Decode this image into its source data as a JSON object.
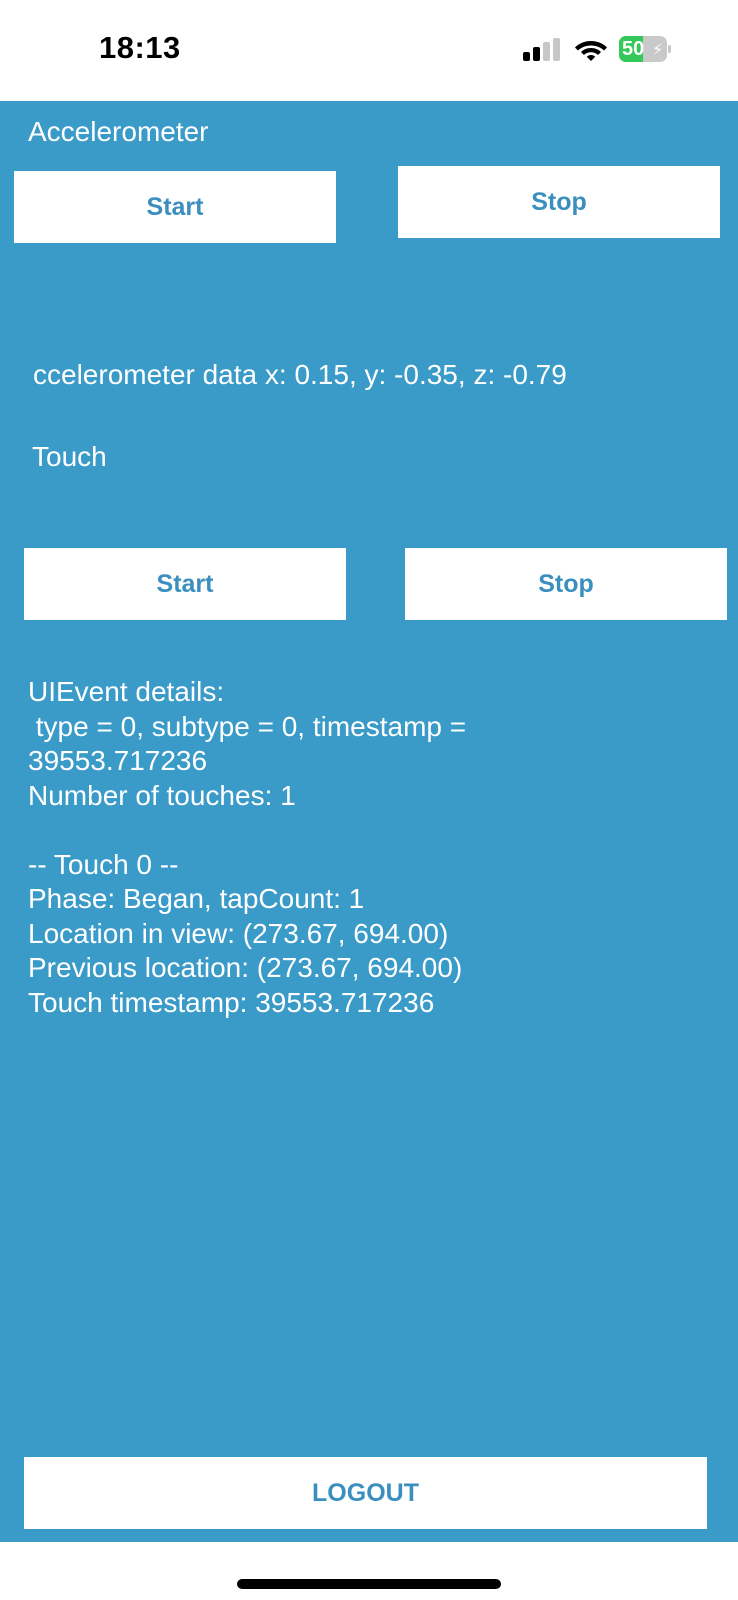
{
  "status_bar": {
    "time": "18:13",
    "battery_level": "50",
    "battery_fraction": 0.5,
    "battery_charging": true,
    "icons": [
      "cellular-signal-icon",
      "wifi-icon",
      "battery-charging-icon"
    ]
  },
  "accelerometer": {
    "title": "Accelerometer",
    "start_label": "Start",
    "stop_label": "Stop",
    "data_text": "ccelerometer data x: 0.15, y: -0.35, z: -0.79"
  },
  "touch": {
    "title": "Touch",
    "start_label": "Start",
    "stop_label": "Stop",
    "event_details": "UIEvent details:\n type = 0, subtype = 0, timestamp =\n39553.717236\nNumber of touches: 1\n\n-- Touch 0 --\nPhase: Began, tapCount: 1\nLocation in view: (273.67, 694.00)\nPrevious location: (273.67, 694.00)\nTouch timestamp: 39553.717236"
  },
  "logout_label": "LOGOUT",
  "colors": {
    "background": "#3a9ac8",
    "button_text": "#3a8fbf",
    "button_bg": "#ffffff",
    "text": "#ffffff"
  }
}
